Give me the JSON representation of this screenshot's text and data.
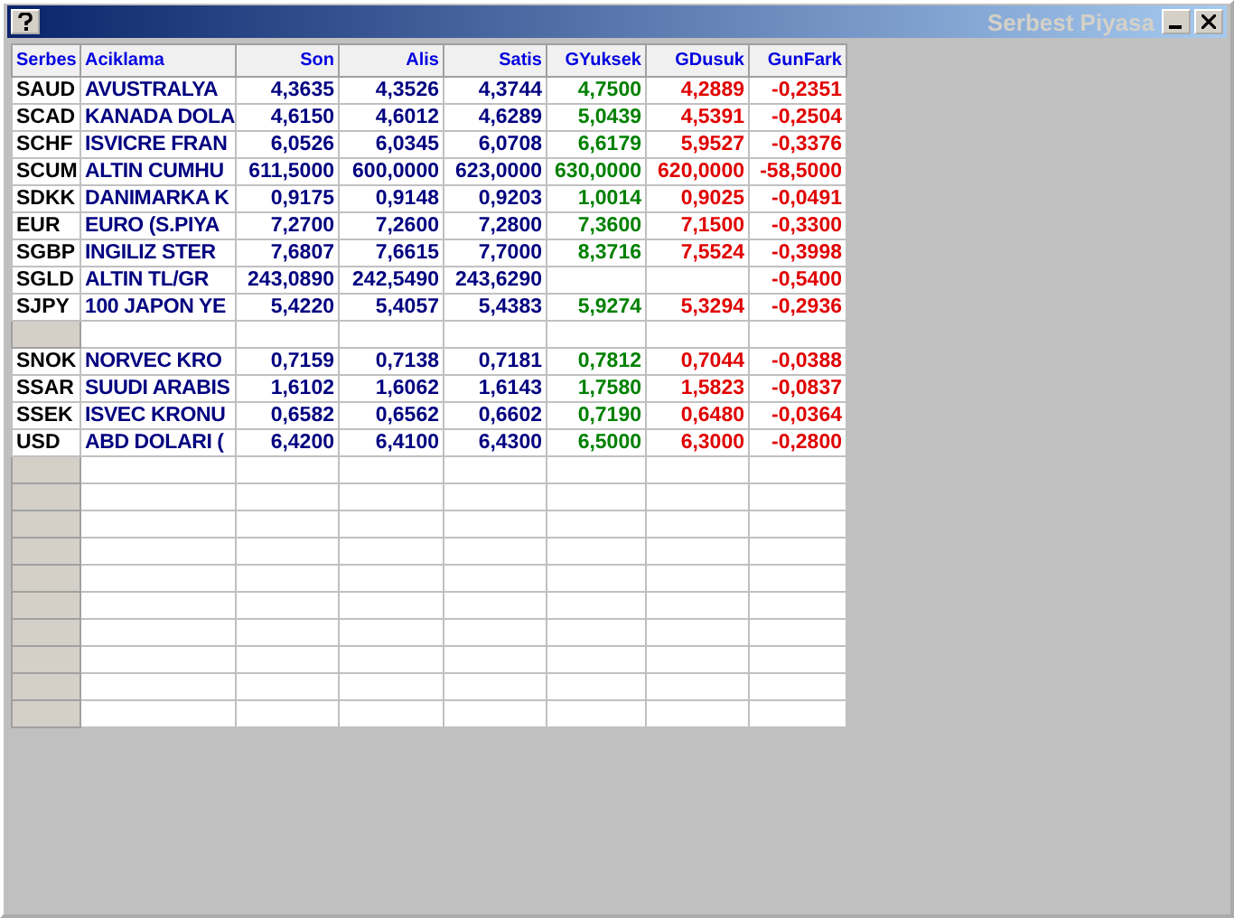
{
  "window": {
    "title": "Serbest Piyasa"
  },
  "table": {
    "columns": [
      "Serbes",
      "Aciklama",
      "Son",
      "Alis",
      "Satis",
      "GYuksek",
      "GDusuk",
      "GunFark"
    ],
    "rows": [
      {
        "kind": "data",
        "code": "SAUD",
        "name": "AVUSTRALYA",
        "son": "4,3635",
        "alis": "4,3526",
        "satis": "4,3744",
        "high": "4,7500",
        "low": "4,2889",
        "change": "-0,2351"
      },
      {
        "kind": "data",
        "code": "SCAD",
        "name": "KANADA DOLA",
        "son": "4,6150",
        "alis": "4,6012",
        "satis": "4,6289",
        "high": "5,0439",
        "low": "4,5391",
        "change": "-0,2504"
      },
      {
        "kind": "data",
        "code": "SCHF",
        "name": "ISVICRE FRAN",
        "son": "6,0526",
        "alis": "6,0345",
        "satis": "6,0708",
        "high": "6,6179",
        "low": "5,9527",
        "change": "-0,3376"
      },
      {
        "kind": "data",
        "code": "SCUM",
        "name": "ALTIN CUMHU",
        "son": "611,5000",
        "alis": "600,0000",
        "satis": "623,0000",
        "high": "630,0000",
        "low": "620,0000",
        "change": "-58,5000"
      },
      {
        "kind": "data",
        "code": "SDKK",
        "name": "DANIMARKA K",
        "son": "0,9175",
        "alis": "0,9148",
        "satis": "0,9203",
        "high": "1,0014",
        "low": "0,9025",
        "change": "-0,0491"
      },
      {
        "kind": "data",
        "code": "EUR",
        "name": "EURO (S.PIYA",
        "son": "7,2700",
        "alis": "7,2600",
        "satis": "7,2800",
        "high": "7,3600",
        "low": "7,1500",
        "change": "-0,3300"
      },
      {
        "kind": "data",
        "code": "SGBP",
        "name": "INGILIZ STER",
        "son": "7,6807",
        "alis": "7,6615",
        "satis": "7,7000",
        "high": "8,3716",
        "low": "7,5524",
        "change": "-0,3998"
      },
      {
        "kind": "data",
        "code": "SGLD",
        "name": "ALTIN TL/GR",
        "son": "243,0890",
        "alis": "242,5490",
        "satis": "243,6290",
        "change": "-0,5400"
      },
      {
        "kind": "data",
        "code": "SJPY",
        "name": "100 JAPON YE",
        "son": "5,4220",
        "alis": "5,4057",
        "satis": "5,4383",
        "high": "5,9274",
        "low": "5,3294",
        "change": "-0,2936"
      },
      {
        "kind": "separator"
      },
      {
        "kind": "data",
        "code": "SNOK",
        "name": "NORVEC KRO",
        "son": "0,7159",
        "alis": "0,7138",
        "satis": "0,7181",
        "high": "0,7812",
        "low": "0,7044",
        "change": "-0,0388"
      },
      {
        "kind": "data",
        "code": "SSAR",
        "name": "SUUDI ARABIS",
        "son": "1,6102",
        "alis": "1,6062",
        "satis": "1,6143",
        "high": "1,7580",
        "low": "1,5823",
        "change": "-0,0837"
      },
      {
        "kind": "data",
        "code": "SSEK",
        "name": "ISVEC KRONU",
        "son": "0,6582",
        "alis": "0,6562",
        "satis": "0,6602",
        "high": "0,7190",
        "low": "0,6480",
        "change": "-0,0364"
      },
      {
        "kind": "data",
        "code": "USD",
        "name": "ABD DOLARI (",
        "son": "6,4200",
        "alis": "6,4100",
        "satis": "6,4300",
        "high": "6,5000",
        "low": "6,3000",
        "change": "-0,2800"
      }
    ]
  }
}
